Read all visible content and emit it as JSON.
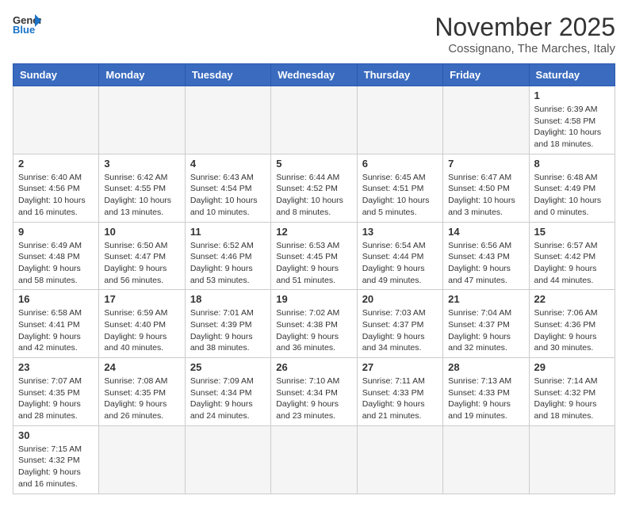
{
  "logo": {
    "text_general": "General",
    "text_blue": "Blue"
  },
  "title": "November 2025",
  "subtitle": "Cossignano, The Marches, Italy",
  "weekdays": [
    "Sunday",
    "Monday",
    "Tuesday",
    "Wednesday",
    "Thursday",
    "Friday",
    "Saturday"
  ],
  "weeks": [
    [
      {
        "day": "",
        "empty": true
      },
      {
        "day": "",
        "empty": true
      },
      {
        "day": "",
        "empty": true
      },
      {
        "day": "",
        "empty": true
      },
      {
        "day": "",
        "empty": true
      },
      {
        "day": "",
        "empty": true
      },
      {
        "day": "1",
        "info": "Sunrise: 6:39 AM\nSunset: 4:58 PM\nDaylight: 10 hours and 18 minutes."
      }
    ],
    [
      {
        "day": "2",
        "info": "Sunrise: 6:40 AM\nSunset: 4:56 PM\nDaylight: 10 hours and 16 minutes."
      },
      {
        "day": "3",
        "info": "Sunrise: 6:42 AM\nSunset: 4:55 PM\nDaylight: 10 hours and 13 minutes."
      },
      {
        "day": "4",
        "info": "Sunrise: 6:43 AM\nSunset: 4:54 PM\nDaylight: 10 hours and 10 minutes."
      },
      {
        "day": "5",
        "info": "Sunrise: 6:44 AM\nSunset: 4:52 PM\nDaylight: 10 hours and 8 minutes."
      },
      {
        "day": "6",
        "info": "Sunrise: 6:45 AM\nSunset: 4:51 PM\nDaylight: 10 hours and 5 minutes."
      },
      {
        "day": "7",
        "info": "Sunrise: 6:47 AM\nSunset: 4:50 PM\nDaylight: 10 hours and 3 minutes."
      },
      {
        "day": "8",
        "info": "Sunrise: 6:48 AM\nSunset: 4:49 PM\nDaylight: 10 hours and 0 minutes."
      }
    ],
    [
      {
        "day": "9",
        "info": "Sunrise: 6:49 AM\nSunset: 4:48 PM\nDaylight: 9 hours and 58 minutes."
      },
      {
        "day": "10",
        "info": "Sunrise: 6:50 AM\nSunset: 4:47 PM\nDaylight: 9 hours and 56 minutes."
      },
      {
        "day": "11",
        "info": "Sunrise: 6:52 AM\nSunset: 4:46 PM\nDaylight: 9 hours and 53 minutes."
      },
      {
        "day": "12",
        "info": "Sunrise: 6:53 AM\nSunset: 4:45 PM\nDaylight: 9 hours and 51 minutes."
      },
      {
        "day": "13",
        "info": "Sunrise: 6:54 AM\nSunset: 4:44 PM\nDaylight: 9 hours and 49 minutes."
      },
      {
        "day": "14",
        "info": "Sunrise: 6:56 AM\nSunset: 4:43 PM\nDaylight: 9 hours and 47 minutes."
      },
      {
        "day": "15",
        "info": "Sunrise: 6:57 AM\nSunset: 4:42 PM\nDaylight: 9 hours and 44 minutes."
      }
    ],
    [
      {
        "day": "16",
        "info": "Sunrise: 6:58 AM\nSunset: 4:41 PM\nDaylight: 9 hours and 42 minutes."
      },
      {
        "day": "17",
        "info": "Sunrise: 6:59 AM\nSunset: 4:40 PM\nDaylight: 9 hours and 40 minutes."
      },
      {
        "day": "18",
        "info": "Sunrise: 7:01 AM\nSunset: 4:39 PM\nDaylight: 9 hours and 38 minutes."
      },
      {
        "day": "19",
        "info": "Sunrise: 7:02 AM\nSunset: 4:38 PM\nDaylight: 9 hours and 36 minutes."
      },
      {
        "day": "20",
        "info": "Sunrise: 7:03 AM\nSunset: 4:37 PM\nDaylight: 9 hours and 34 minutes."
      },
      {
        "day": "21",
        "info": "Sunrise: 7:04 AM\nSunset: 4:37 PM\nDaylight: 9 hours and 32 minutes."
      },
      {
        "day": "22",
        "info": "Sunrise: 7:06 AM\nSunset: 4:36 PM\nDaylight: 9 hours and 30 minutes."
      }
    ],
    [
      {
        "day": "23",
        "info": "Sunrise: 7:07 AM\nSunset: 4:35 PM\nDaylight: 9 hours and 28 minutes."
      },
      {
        "day": "24",
        "info": "Sunrise: 7:08 AM\nSunset: 4:35 PM\nDaylight: 9 hours and 26 minutes."
      },
      {
        "day": "25",
        "info": "Sunrise: 7:09 AM\nSunset: 4:34 PM\nDaylight: 9 hours and 24 minutes."
      },
      {
        "day": "26",
        "info": "Sunrise: 7:10 AM\nSunset: 4:34 PM\nDaylight: 9 hours and 23 minutes."
      },
      {
        "day": "27",
        "info": "Sunrise: 7:11 AM\nSunset: 4:33 PM\nDaylight: 9 hours and 21 minutes."
      },
      {
        "day": "28",
        "info": "Sunrise: 7:13 AM\nSunset: 4:33 PM\nDaylight: 9 hours and 19 minutes."
      },
      {
        "day": "29",
        "info": "Sunrise: 7:14 AM\nSunset: 4:32 PM\nDaylight: 9 hours and 18 minutes."
      }
    ],
    [
      {
        "day": "30",
        "info": "Sunrise: 7:15 AM\nSunset: 4:32 PM\nDaylight: 9 hours and 16 minutes."
      },
      {
        "day": "",
        "empty": true
      },
      {
        "day": "",
        "empty": true
      },
      {
        "day": "",
        "empty": true
      },
      {
        "day": "",
        "empty": true
      },
      {
        "day": "",
        "empty": true
      },
      {
        "day": "",
        "empty": true
      }
    ]
  ]
}
